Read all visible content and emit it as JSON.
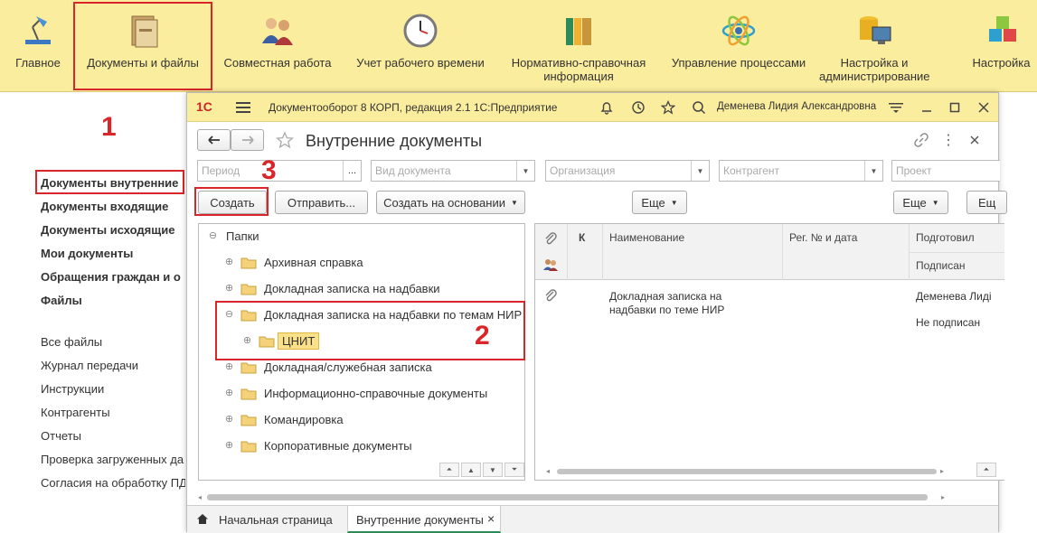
{
  "sections": [
    {
      "label": "Главное",
      "icon": "home-desk-lamp-icon"
    },
    {
      "label": "Документы и файлы",
      "icon": "document-folder-icon"
    },
    {
      "label": "Совместная работа",
      "icon": "people-collaboration-icon"
    },
    {
      "label": "Учет рабочего времени",
      "icon": "clock-icon"
    },
    {
      "label": "Нормативно-справочная информация",
      "icon": "binders-icon"
    },
    {
      "label": "Управление процессами",
      "icon": "process-atom-icon"
    },
    {
      "label": "Настройка и администрирование",
      "icon": "database-monitor-icon"
    },
    {
      "label": "Настройка",
      "icon": "cubes-icon"
    }
  ],
  "left_nav": {
    "bold_items": [
      "Документы внутренние",
      "Документы входящие",
      "Документы исходящие",
      "Мои документы",
      "Обращения граждан и о",
      "Файлы"
    ],
    "items": [
      "Все файлы",
      "Журнал передачи",
      "Инструкции",
      "Контрагенты",
      "Отчеты",
      "Проверка загруженных да",
      "Согласия на обработку ПД"
    ]
  },
  "annotations": [
    "1",
    "2",
    "3"
  ],
  "window": {
    "logo": "1С",
    "title": "Документооборот 8 КОРП, редакция 2.1 1С:Предприятие",
    "user": "Деменева Лидия Александровна",
    "form_title": "Внутренние документы",
    "filters": {
      "period_placeholder": "Период",
      "period_button": "...",
      "doc_type_placeholder": "Вид документа",
      "org_placeholder": "Организация",
      "contractor_placeholder": "Контрагент",
      "project_placeholder": "Проект"
    },
    "toolbar": {
      "create": "Создать",
      "send": "Отправить...",
      "create_based": "Создать на основании",
      "more1": "Еще",
      "more2": "Еще",
      "more3": "Ещ"
    },
    "tree": {
      "root": "Папки",
      "items": [
        "Архивная справка",
        "Докладная записка на надбавки",
        "Докладная записка на надбавки по темам НИР",
        "ЦНИТ",
        "Докладная/служебная записка",
        "Информационно-справочные документы",
        "Командировка",
        "Корпоративные документы"
      ]
    },
    "list": {
      "col_k": "К",
      "col_name": "Наименование",
      "col_reg": "Рег. № и дата",
      "col_prepared": "Подготовил",
      "col_signed": "Подписан",
      "row": {
        "name_line1": "Докладная записка на",
        "name_line2": "надбавки по теме НИР",
        "prepared": "Деменева Лиді",
        "signed": "Не подписан"
      }
    },
    "tabs": {
      "home": "Начальная страница",
      "current": "Внутренние документы",
      "close": "×"
    }
  }
}
